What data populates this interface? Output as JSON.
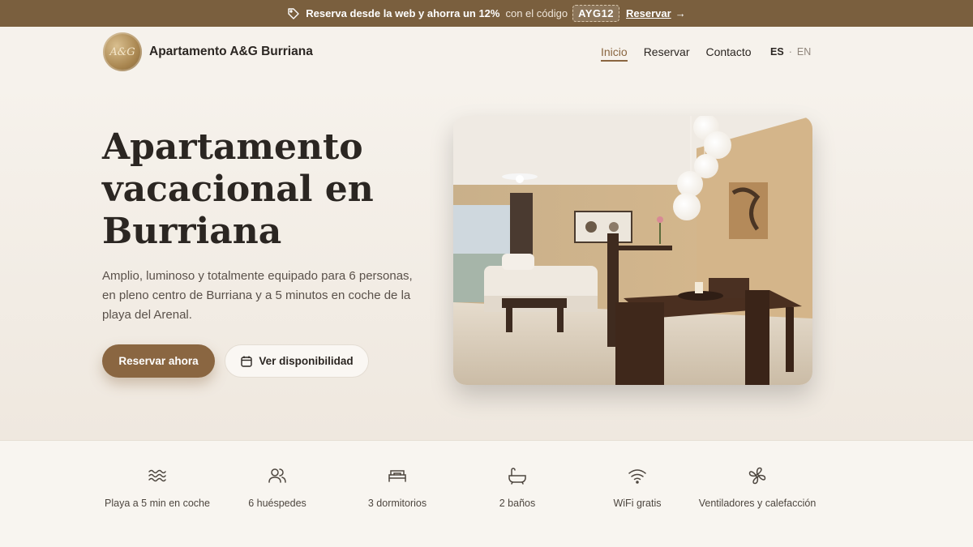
{
  "promo": {
    "headline": "Reserva desde la web y ahorra un 12%",
    "subtext": "con el código",
    "code": "AYG12",
    "link_label": "Reservar",
    "arrow": "→",
    "icon": "tag-icon"
  },
  "header": {
    "logo_text": "A&G",
    "brand": "Apartamento A&G Burriana",
    "nav": [
      {
        "label": "Inicio",
        "active": true
      },
      {
        "label": "Reservar",
        "active": false
      },
      {
        "label": "Contacto",
        "active": false
      }
    ],
    "languages": {
      "current": "ES",
      "separator": "·",
      "other": "EN"
    }
  },
  "hero": {
    "title": "Apartamento vacacional en Burriana",
    "description": "Amplio, luminoso y totalmente equipado para 6 personas, en pleno centro de Burriana y a 5 minutos en coche de la playa del Arenal.",
    "primary_button": "Reservar ahora",
    "secondary_button": "Ver disponibilidad",
    "secondary_icon": "calendar-icon"
  },
  "features": [
    {
      "icon": "waves-icon",
      "label": "Playa a 5 min en coche"
    },
    {
      "icon": "users-icon",
      "label": "6 huéspedes"
    },
    {
      "icon": "bed-icon",
      "label": "3 dormitorios"
    },
    {
      "icon": "bath-icon",
      "label": "2 baños"
    },
    {
      "icon": "wifi-icon",
      "label": "WiFi gratis"
    },
    {
      "icon": "fan-icon",
      "label": "Ventiladores y calefacción"
    }
  ],
  "colors": {
    "accent": "#8a6641",
    "promo_bar": "#7a5f3e",
    "background": "#f7f3ee",
    "text": "#2b2622"
  }
}
